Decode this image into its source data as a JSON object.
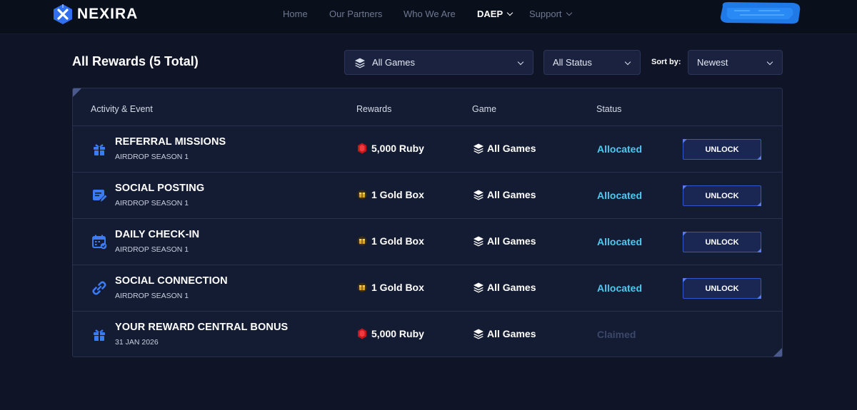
{
  "brand": {
    "name": "NEXIRA"
  },
  "nav": [
    {
      "label": "Home"
    },
    {
      "label": "Our Partners"
    },
    {
      "label": "Who We Are"
    },
    {
      "label": "DAEP"
    },
    {
      "label": "Support"
    }
  ],
  "page": {
    "title": "All Rewards (5 Total)"
  },
  "filters": {
    "games": "All Games",
    "status": "All Status",
    "sort_label": "Sort by:",
    "sort": "Newest"
  },
  "table": {
    "headers": [
      "Activity & Event",
      "Rewards",
      "Game",
      "Status"
    ],
    "rows": [
      {
        "title": "REFERRAL MISSIONS",
        "subtitle": "AIRDROP SEASON 1",
        "icon": "gift-icon",
        "reward": "5,000 Ruby",
        "reward_icon": "ruby-icon",
        "game": "All Games",
        "status": "Allocated",
        "action": "UNLOCK"
      },
      {
        "title": "SOCIAL POSTING",
        "subtitle": "AIRDROP SEASON 1",
        "icon": "post-icon",
        "reward": "1 Gold Box",
        "reward_icon": "gold-box-icon",
        "game": "All Games",
        "status": "Allocated",
        "action": "UNLOCK"
      },
      {
        "title": "DAILY CHECK-IN",
        "subtitle": "AIRDROP SEASON 1",
        "icon": "calendar-check-icon",
        "reward": "1 Gold Box",
        "reward_icon": "gold-box-icon",
        "game": "All Games",
        "status": "Allocated",
        "action": "UNLOCK"
      },
      {
        "title": "SOCIAL CONNECTION",
        "subtitle": "AIRDROP SEASON 1",
        "icon": "link-icon",
        "reward": "1 Gold Box",
        "reward_icon": "gold-box-icon",
        "game": "All Games",
        "status": "Allocated",
        "action": "UNLOCK"
      },
      {
        "title": "YOUR REWARD CENTRAL BONUS",
        "subtitle": "31 JAN 2026",
        "icon": "gift-icon",
        "reward": "5,000 Ruby",
        "reward_icon": "ruby-icon",
        "game": "All Games",
        "status": "Claimed",
        "action": ""
      }
    ]
  },
  "colors": {
    "background": "#0f1527",
    "allocated": "#4cc9f0",
    "claimed": "#3b4768",
    "accent": "#2e6ff0"
  }
}
